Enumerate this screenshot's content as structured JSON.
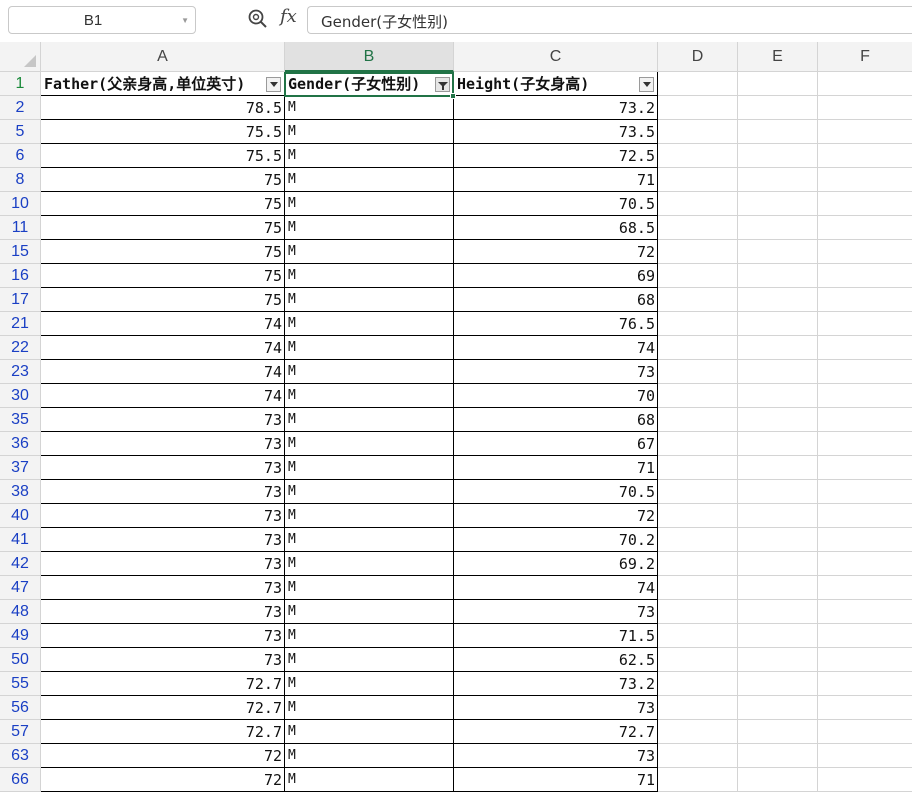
{
  "formula_bar": {
    "name_box": "B1",
    "fx_label": "fx",
    "formula": "Gender(子女性别)"
  },
  "columns": [
    "A",
    "B",
    "C",
    "D",
    "E",
    "F"
  ],
  "selected_column": "B",
  "headers": {
    "A": "Father(父亲身高,单位英寸)",
    "B": "Gender(子女性别)",
    "C": "Height(子女身高)"
  },
  "rows": [
    {
      "row": "2",
      "father": "78.5",
      "gender": "M",
      "height": "73.2"
    },
    {
      "row": "5",
      "father": "75.5",
      "gender": "M",
      "height": "73.5"
    },
    {
      "row": "6",
      "father": "75.5",
      "gender": "M",
      "height": "72.5"
    },
    {
      "row": "8",
      "father": "75",
      "gender": "M",
      "height": "71"
    },
    {
      "row": "10",
      "father": "75",
      "gender": "M",
      "height": "70.5"
    },
    {
      "row": "11",
      "father": "75",
      "gender": "M",
      "height": "68.5"
    },
    {
      "row": "15",
      "father": "75",
      "gender": "M",
      "height": "72"
    },
    {
      "row": "16",
      "father": "75",
      "gender": "M",
      "height": "69"
    },
    {
      "row": "17",
      "father": "75",
      "gender": "M",
      "height": "68"
    },
    {
      "row": "21",
      "father": "74",
      "gender": "M",
      "height": "76.5"
    },
    {
      "row": "22",
      "father": "74",
      "gender": "M",
      "height": "74"
    },
    {
      "row": "23",
      "father": "74",
      "gender": "M",
      "height": "73"
    },
    {
      "row": "30",
      "father": "74",
      "gender": "M",
      "height": "70"
    },
    {
      "row": "35",
      "father": "73",
      "gender": "M",
      "height": "68"
    },
    {
      "row": "36",
      "father": "73",
      "gender": "M",
      "height": "67"
    },
    {
      "row": "37",
      "father": "73",
      "gender": "M",
      "height": "71"
    },
    {
      "row": "38",
      "father": "73",
      "gender": "M",
      "height": "70.5"
    },
    {
      "row": "40",
      "father": "73",
      "gender": "M",
      "height": "72"
    },
    {
      "row": "41",
      "father": "73",
      "gender": "M",
      "height": "70.2"
    },
    {
      "row": "42",
      "father": "73",
      "gender": "M",
      "height": "69.2"
    },
    {
      "row": "47",
      "father": "73",
      "gender": "M",
      "height": "74"
    },
    {
      "row": "48",
      "father": "73",
      "gender": "M",
      "height": "73"
    },
    {
      "row": "49",
      "father": "73",
      "gender": "M",
      "height": "71.5"
    },
    {
      "row": "50",
      "father": "73",
      "gender": "M",
      "height": "62.5"
    },
    {
      "row": "55",
      "father": "72.7",
      "gender": "M",
      "height": "73.2"
    },
    {
      "row": "56",
      "father": "72.7",
      "gender": "M",
      "height": "73"
    },
    {
      "row": "57",
      "father": "72.7",
      "gender": "M",
      "height": "72.7"
    },
    {
      "row": "63",
      "father": "72",
      "gender": "M",
      "height": "73"
    },
    {
      "row": "66",
      "father": "72",
      "gender": "M",
      "height": "71"
    }
  ],
  "colors": {
    "accent": "#217346",
    "row_number": "#1a3fc4"
  }
}
